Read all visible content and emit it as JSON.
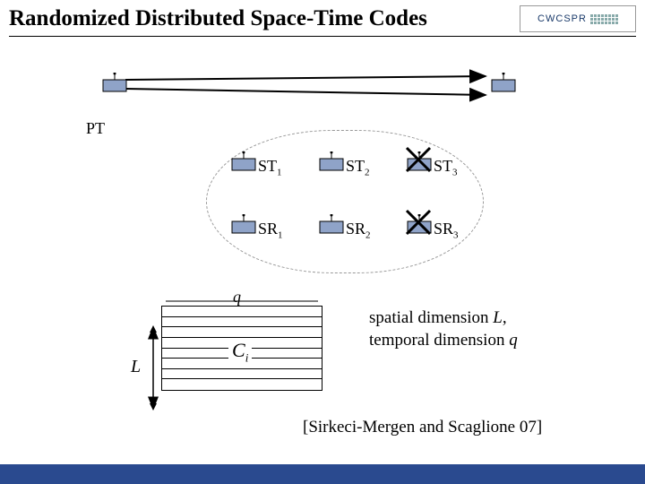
{
  "header": {
    "title": "Randomized Distributed Space-Time Codes",
    "logo_text": "CWCSPR"
  },
  "nodes": {
    "PT": "PT",
    "ST1_base": "ST",
    "ST1_sub": "1",
    "ST2_base": "ST",
    "ST2_sub": "2",
    "ST3_base": "ST",
    "ST3_sub": "3",
    "SR1_base": "SR",
    "SR1_sub": "1",
    "SR2_base": "SR",
    "SR2_sub": "2",
    "SR3_base": "SR",
    "SR3_sub": "3"
  },
  "matrix": {
    "q": "q",
    "L": "L",
    "C_base": "C",
    "C_sub": "i",
    "dim_line1": "spatial dimension",
    "dim_L": "L",
    "dim_sep": ",",
    "dim_line2": "temporal dimension",
    "dim_q": "q"
  },
  "citation": "[Sirkeci-Mergen and Scaglione 07]",
  "colors": {
    "node_fill": "#8fa3c8",
    "node_stroke": "#000",
    "footer": "#2a4a8f"
  }
}
